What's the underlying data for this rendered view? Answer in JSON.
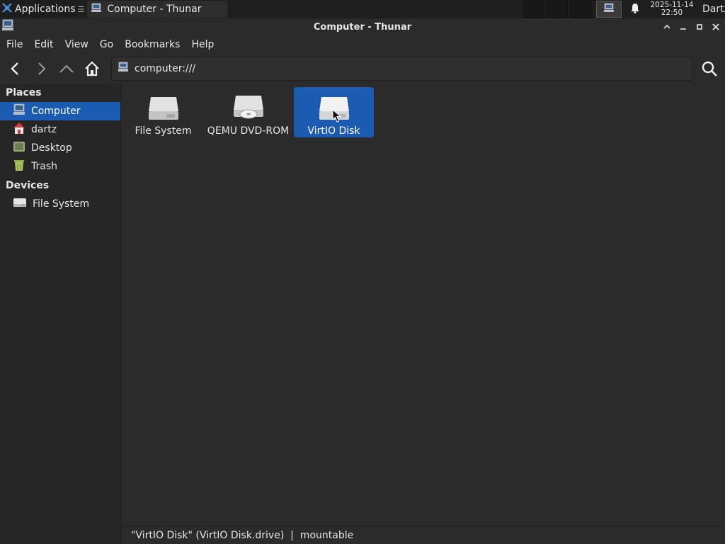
{
  "panel": {
    "apps_label": "Applications",
    "apps_separator": "☰",
    "task_title": "Computer - Thunar",
    "clock_date": "2025-11-14",
    "clock_time": "22:50",
    "user": "Dartz"
  },
  "window": {
    "title": "Computer - Thunar"
  },
  "menu": {
    "file": "File",
    "edit": "Edit",
    "view": "View",
    "go": "Go",
    "bookmarks": "Bookmarks",
    "help": "Help"
  },
  "location": {
    "path": "computer:///"
  },
  "sidebar": {
    "places_heading": "Places",
    "places": [
      {
        "label": "Computer",
        "icon": "computer-icon",
        "selected": true
      },
      {
        "label": "dartz",
        "icon": "home-folder-icon"
      },
      {
        "label": "Desktop",
        "icon": "desktop-icon"
      },
      {
        "label": "Trash",
        "icon": "trash-icon"
      }
    ],
    "devices_heading": "Devices",
    "devices": [
      {
        "label": "File System",
        "icon": "drive-icon"
      }
    ]
  },
  "items": [
    {
      "label": "File System",
      "icon": "harddisk-icon"
    },
    {
      "label": "QEMU DVD-ROM",
      "icon": "optical-drive-icon"
    },
    {
      "label": "VirtIO Disk",
      "icon": "harddisk-icon",
      "selected": true
    }
  ],
  "status": {
    "text": "\"VirtIO Disk\" (VirtIO Disk.drive)  |  mountable"
  },
  "colors": {
    "accent": "#1c5bb2",
    "background": "#2b2b2b",
    "sidebar": "#262626",
    "panel": "#1e1e1e"
  }
}
